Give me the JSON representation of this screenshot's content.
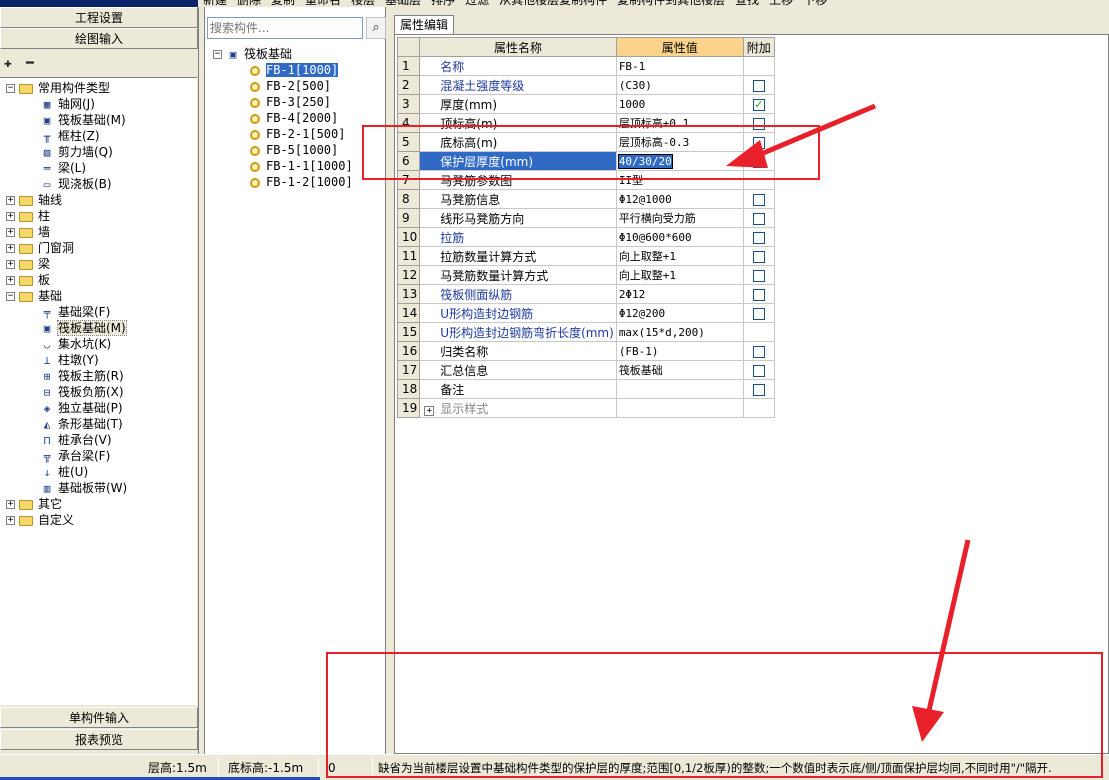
{
  "toolbar": {
    "items": [
      "新建",
      "删除",
      "复制",
      "重命名",
      "楼层",
      "基础层",
      "排序",
      "过滤",
      "从其他楼层复制构件",
      "复制构件到其他楼层",
      "查找",
      "上移",
      "下移"
    ]
  },
  "left_panel": {
    "project_settings": "工程设置",
    "drawing_input": "绘图输入",
    "single_component_input": "单构件输入",
    "report_preview": "报表预览",
    "tools": {
      "expand": "✚",
      "collapse": "━"
    },
    "tree": {
      "common_types": "常用构件类型",
      "common_children": [
        "轴网(J)",
        "筏板基础(M)",
        "框柱(Z)",
        "剪力墙(Q)",
        "梁(L)",
        "现浇板(B)"
      ],
      "groups_a": [
        "轴线",
        "柱",
        "墙",
        "门窗洞",
        "梁",
        "板"
      ],
      "foundation": "基础",
      "foundation_children": [
        "基础梁(F)",
        "筏板基础(M)",
        "集水坑(K)",
        "柱墩(Y)",
        "筏板主筋(R)",
        "筏板负筋(X)",
        "独立基础(P)",
        "条形基础(T)",
        "桩承台(V)",
        "承台梁(F)",
        "桩(U)",
        "基础板带(W)"
      ],
      "groups_b": [
        "其它",
        "自定义"
      ]
    }
  },
  "component_panel": {
    "search_placeholder": "搜索构件...",
    "search_icon": "magnifier-icon",
    "root": "筏板基础",
    "items": [
      "FB-1[1000]",
      "FB-2[500]",
      "FB-3[250]",
      "FB-4[2000]",
      "FB-2-1[500]",
      "FB-5[1000]",
      "FB-1-1[1000]",
      "FB-1-2[1000]"
    ],
    "selected_index": 0
  },
  "property_panel": {
    "tab": "属性编辑",
    "headers": {
      "name": "属性名称",
      "value": "属性值",
      "extra": "附加"
    },
    "rows": [
      {
        "num": "1",
        "name": "名称",
        "value": "FB-1",
        "checkbox": false,
        "blue": true
      },
      {
        "num": "2",
        "name": "混凝土强度等级",
        "value": "(C30)",
        "checkbox": true,
        "checked": false,
        "blue": true
      },
      {
        "num": "3",
        "name": "厚度(mm)",
        "value": "1000",
        "checkbox": true,
        "checked": true,
        "blue": false
      },
      {
        "num": "4",
        "name": "顶标高(m)",
        "value": "层顶标高+0.1",
        "checkbox": true,
        "checked": false,
        "blue": false
      },
      {
        "num": "5",
        "name": "底标高(m)",
        "value": "层顶标高-0.3",
        "checkbox": true,
        "checked": false,
        "blue": false
      },
      {
        "num": "6",
        "name": "保护层厚度(mm)",
        "value": "40/30/20",
        "checkbox": true,
        "checked": false,
        "blue": false,
        "selected": true
      },
      {
        "num": "7",
        "name": "马凳筋参数图",
        "value": "II型",
        "checkbox": false,
        "blue": false
      },
      {
        "num": "8",
        "name": "马凳筋信息",
        "value": "Φ12@1000",
        "checkbox": true,
        "checked": false,
        "blue": false
      },
      {
        "num": "9",
        "name": "线形马凳筋方向",
        "value": "平行横向受力筋",
        "checkbox": true,
        "checked": false,
        "blue": false
      },
      {
        "num": "10",
        "name": "拉筋",
        "value": "Φ10@600*600",
        "checkbox": true,
        "checked": false,
        "blue": true
      },
      {
        "num": "11",
        "name": "拉筋数量计算方式",
        "value": "向上取整+1",
        "checkbox": true,
        "checked": false,
        "blue": false
      },
      {
        "num": "12",
        "name": "马凳筋数量计算方式",
        "value": "向上取整+1",
        "checkbox": true,
        "checked": false,
        "blue": false
      },
      {
        "num": "13",
        "name": "筏板侧面纵筋",
        "value": "2Φ12",
        "checkbox": true,
        "checked": false,
        "blue": true
      },
      {
        "num": "14",
        "name": "U形构造封边钢筋",
        "value": "Φ12@200",
        "checkbox": true,
        "checked": false,
        "blue": true
      },
      {
        "num": "15",
        "name": "U形构造封边钢筋弯折长度(mm)",
        "value": "max(15*d,200)",
        "checkbox": false,
        "blue": true
      },
      {
        "num": "16",
        "name": "归类名称",
        "value": "(FB-1)",
        "checkbox": true,
        "checked": false,
        "blue": false
      },
      {
        "num": "17",
        "name": "汇总信息",
        "value": "筏板基础",
        "checkbox": true,
        "checked": false,
        "blue": false
      },
      {
        "num": "18",
        "name": "备注",
        "value": "",
        "checkbox": true,
        "checked": false,
        "blue": false
      },
      {
        "num": "19",
        "name": "显示样式",
        "value": "",
        "checkbox": false,
        "blue": false,
        "expandable": true,
        "grey": true
      }
    ]
  },
  "status_bar": {
    "floor_height": "层高:1.5m",
    "bottom_elevation": "底标高:-1.5m",
    "zero": "0",
    "hint": "缺省为当前楼层设置中基础构件类型的保护层的厚度;范围[0,1/2板厚)的整数;一个数值时表示底/侧/顶面保护层均同,不同时用\"/\"隔开."
  },
  "colors": {
    "annotation": "#e8202a",
    "selection": "#316ac5",
    "header_value": "#fbd38a"
  }
}
